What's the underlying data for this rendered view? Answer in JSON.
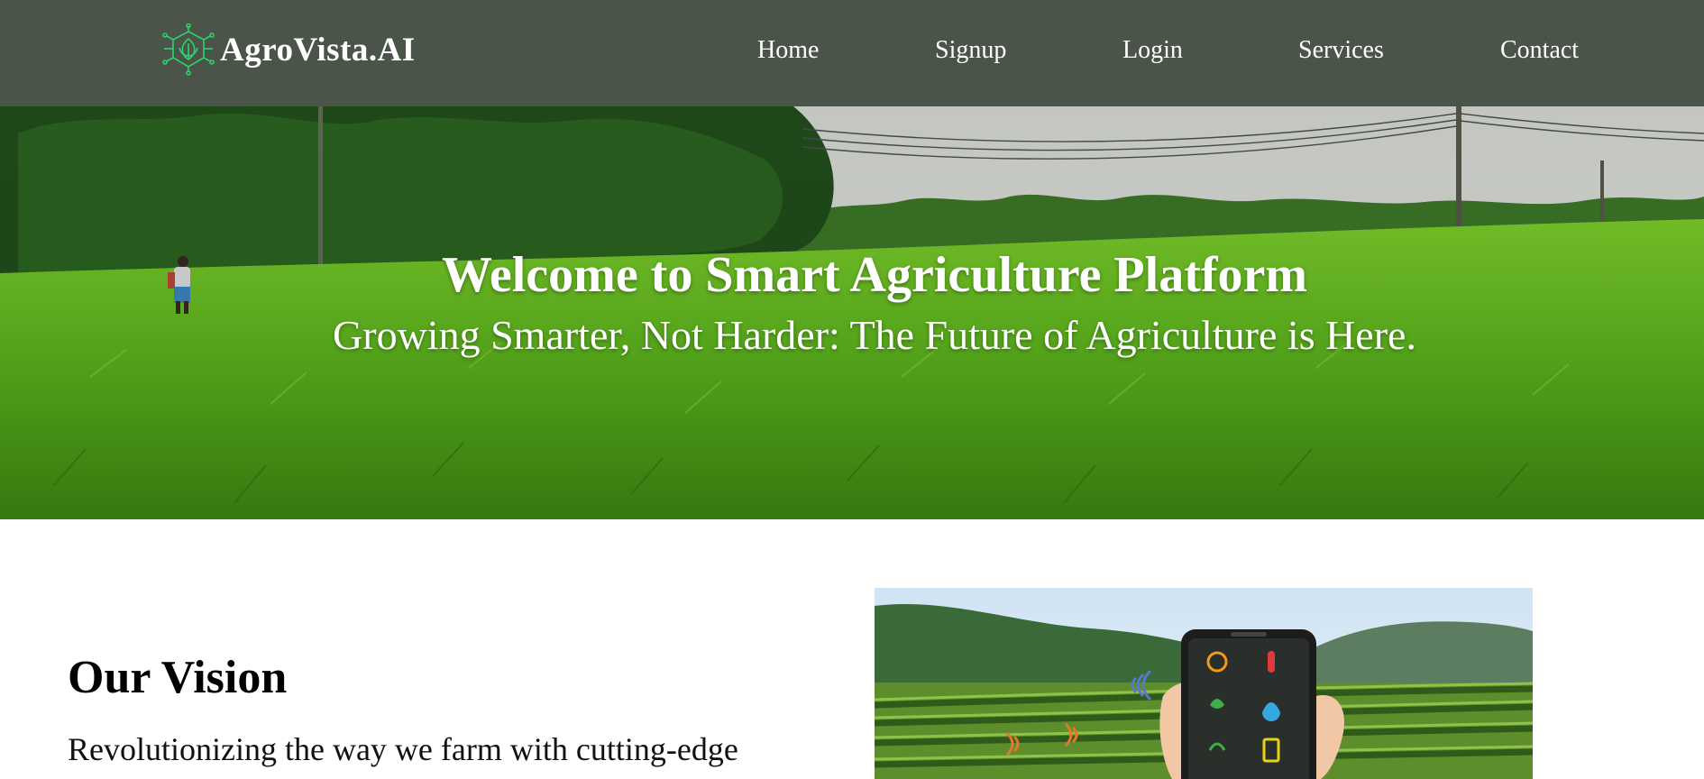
{
  "header": {
    "brand_name": "AgroVista.AI",
    "logo_icon": "circuit-leaf-icon",
    "nav": [
      {
        "label": "Home"
      },
      {
        "label": "Signup"
      },
      {
        "label": "Login"
      },
      {
        "label": "Services"
      },
      {
        "label": "Contact"
      }
    ]
  },
  "hero": {
    "title": "Welcome to Smart Agriculture Platform",
    "subtitle": "Growing Smarter, Not Harder: The Future of Agriculture is Here."
  },
  "vision": {
    "title": "Our Vision",
    "text": "Revolutionizing the way we farm with cutting-edge technology and sustainable practices."
  },
  "colors": {
    "navbar_bg": "#4a5449",
    "logo_green": "#2fd16a",
    "text_white": "#ffffff"
  }
}
